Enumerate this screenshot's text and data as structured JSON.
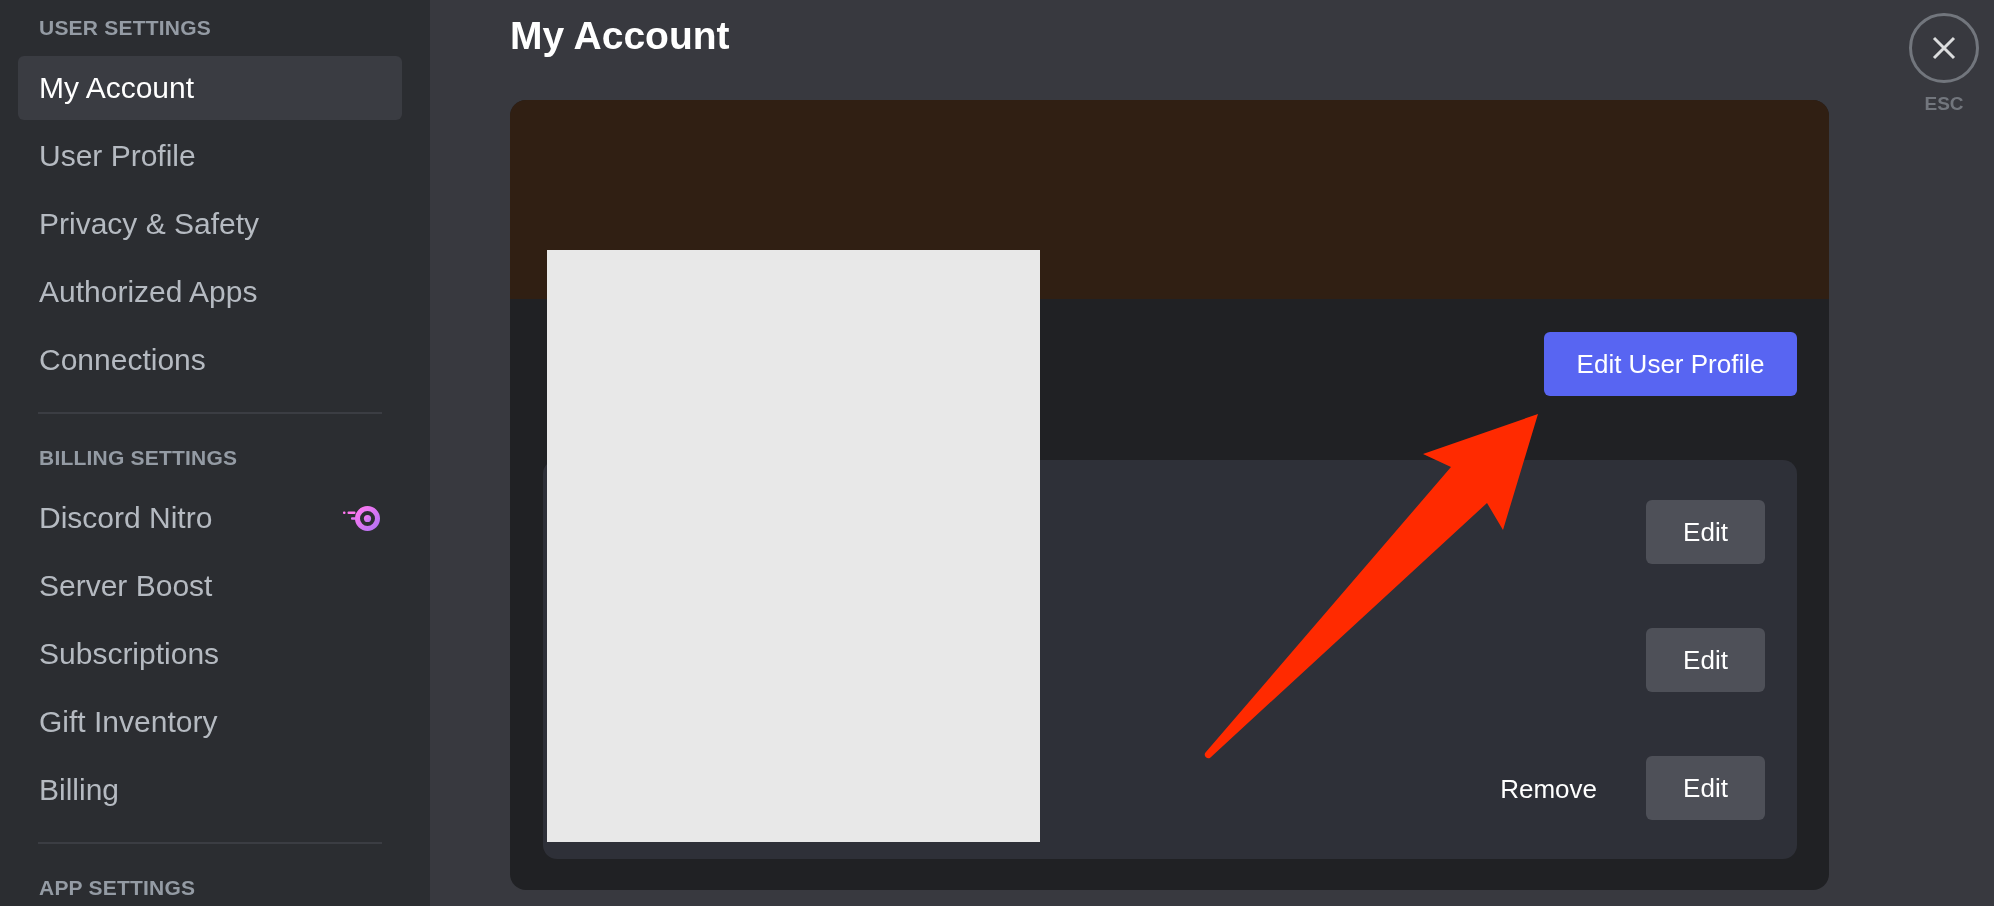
{
  "sidebar": {
    "sections": [
      {
        "heading": "USER SETTINGS",
        "items": [
          {
            "label": "My Account",
            "selected": true,
            "badge": false
          },
          {
            "label": "User Profile",
            "selected": false,
            "badge": false
          },
          {
            "label": "Privacy & Safety",
            "selected": false,
            "badge": false
          },
          {
            "label": "Authorized Apps",
            "selected": false,
            "badge": false
          },
          {
            "label": "Connections",
            "selected": false,
            "badge": false
          }
        ]
      },
      {
        "heading": "BILLING SETTINGS",
        "items": [
          {
            "label": "Discord Nitro",
            "selected": false,
            "badge": true
          },
          {
            "label": "Server Boost",
            "selected": false,
            "badge": false
          },
          {
            "label": "Subscriptions",
            "selected": false,
            "badge": false
          },
          {
            "label": "Gift Inventory",
            "selected": false,
            "badge": false
          },
          {
            "label": "Billing",
            "selected": false,
            "badge": false
          }
        ]
      },
      {
        "heading": "APP SETTINGS"
      }
    ]
  },
  "page": {
    "title": "My Account"
  },
  "close": {
    "label": "ESC"
  },
  "profile_card": {
    "edit_profile_button": "Edit User Profile",
    "rows": [
      {
        "actions": [
          {
            "kind": "button",
            "label": "Edit"
          }
        ]
      },
      {
        "actions": [
          {
            "kind": "button",
            "label": "Edit"
          }
        ]
      },
      {
        "actions": [
          {
            "kind": "link",
            "label": "Remove"
          },
          {
            "kind": "button",
            "label": "Edit"
          }
        ]
      }
    ]
  }
}
